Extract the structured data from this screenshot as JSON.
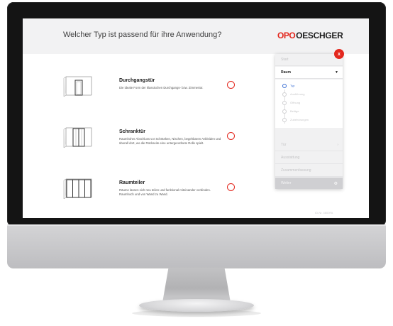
{
  "page": {
    "title": "Welcher Typ ist passend für ihre Anwendung?",
    "brand_mark": "OPO",
    "brand_name": "OESCHGER"
  },
  "options": [
    {
      "title": "Durchgangstür",
      "description": "Die ideale Form der klassischen Durchgangs- bzw. Zimmertür.",
      "icon": "single-door-icon"
    },
    {
      "title": "Schranktür",
      "description": "Raumhoher Abschluss vor Schränken, Nischen, begehbaren Ankleiden und überall dort, wo die Rückseite eine untergeordnete Rolle spielt.",
      "icon": "cabinet-door-icon"
    },
    {
      "title": "Raumteiler",
      "description": "Räume lassen sich neu teilen und funktional miteinander verbinden. Raumhoch und von Wand zu Wand.",
      "icon": "room-divider-icon"
    }
  ],
  "panel": {
    "close_label": "x",
    "start_label": "Start",
    "room_label": "Raum",
    "steps": [
      "Typ",
      "Ausführung",
      "Öffnung",
      "Beläge",
      "Zubehörungen"
    ],
    "active_step": "Typ",
    "sub_label": "Tür",
    "section_1": "Ausstattung",
    "section_2": "Zusammenfassung",
    "next_label": "Weiter"
  },
  "footer": {
    "note": "ID-Nr. 4600FA"
  },
  "colors": {
    "accent": "#e3281e",
    "selected": "#3b6fd4",
    "header_bg": "#f2f2f3"
  }
}
